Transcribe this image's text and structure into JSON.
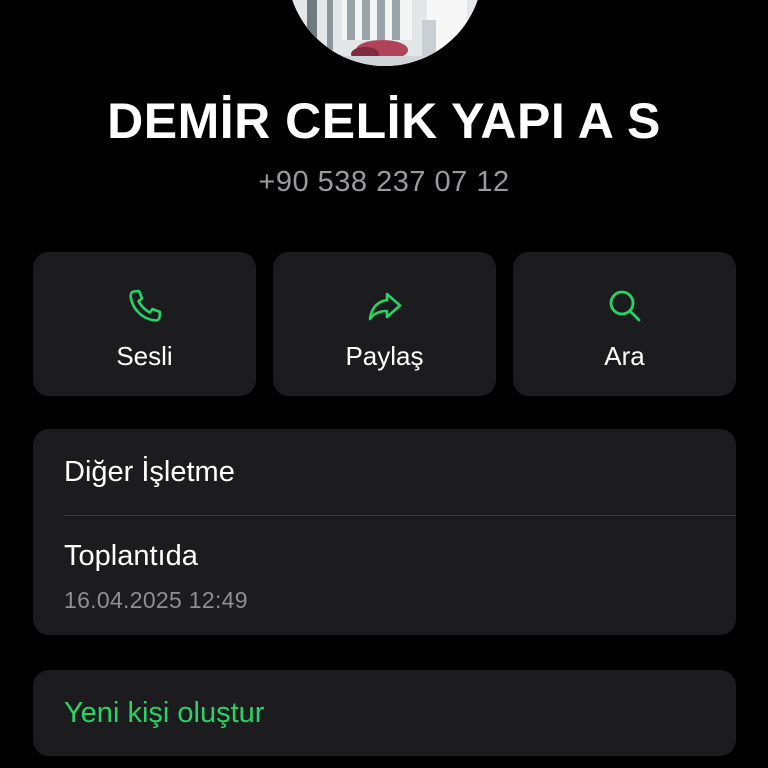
{
  "contact": {
    "name": "DEMİR CELİK YAPI A S",
    "phone": "+90 538 237 07 12",
    "avatar_icon": "building-photo"
  },
  "actions": [
    {
      "label": "Sesli",
      "icon": "phone-icon"
    },
    {
      "label": "Paylaş",
      "icon": "share-arrow-icon"
    },
    {
      "label": "Ara",
      "icon": "search-icon"
    }
  ],
  "info": {
    "category": "Diğer İşletme",
    "status": "Toplantıda",
    "status_timestamp": "16.04.2025 12:49"
  },
  "create_contact": {
    "label": "Yeni kişi oluştur"
  },
  "colors": {
    "background": "#000000",
    "card": "#1c1c1e",
    "accent": "#25d366",
    "secondary_text": "#8e8e93"
  }
}
